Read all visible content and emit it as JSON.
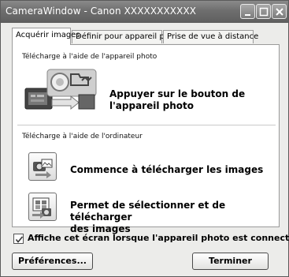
{
  "window": {
    "title": "CameraWindow - Canon XXXXXXXXXXX"
  },
  "tabs": [
    {
      "label": "Acquérir images",
      "active": true
    },
    {
      "label": "Définir pour appareil photo",
      "active": false
    },
    {
      "label": "Prise de vue à distance",
      "active": false
    }
  ],
  "section_camera": {
    "label": "Télécharge à l'aide de l'appareil photo",
    "action_line1": "Appuyer sur le bouton de",
    "action_line2": "l'appareil photo"
  },
  "section_computer": {
    "label": "Télécharge à l'aide de l'ordinateur",
    "start_download_line1": "Commence à télécharger les images",
    "select_download_line1": "Permet de sélectionner et de télécharger",
    "select_download_line2": "des images"
  },
  "footer": {
    "show_on_connect_checked": true,
    "show_on_connect_label": "Affiche cet écran lorsque l'appareil photo est connecté",
    "preferences_label": "Préférences...",
    "finish_label": "Terminer"
  },
  "icons": {
    "minimize": "minimize-icon",
    "maximize": "maximize-icon",
    "close": "close-icon",
    "camera_graphic": "camera-download-icon",
    "start_download": "download-images-icon",
    "select_download": "select-download-icon",
    "check": "checkmark-icon"
  }
}
